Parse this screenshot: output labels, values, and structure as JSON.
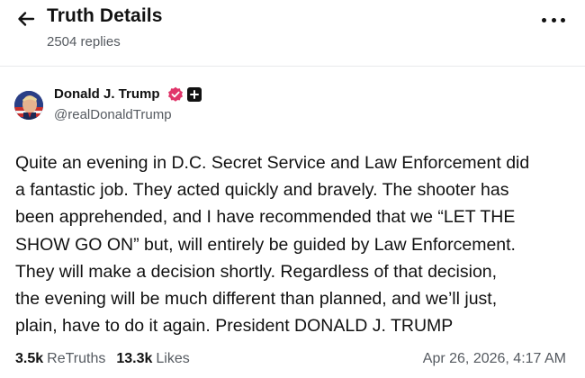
{
  "header": {
    "title": "Truth Details",
    "replies": "2504 replies"
  },
  "author": {
    "name": "Donald J. Trump",
    "handle": "@realDonaldTrump"
  },
  "post": {
    "text": "Quite an evening in D.C. Secret Service and Law Enforcement did\na fantastic job. They acted quickly and bravely. The shooter has\nbeen apprehended, and I have recommended that we “LET THE\nSHOW GO ON” but, will entirely be guided by Law Enforcement.\nThey will make a decision shortly. Regardless of that decision,\nthe evening will be much different than planned, and we’ll just,\nplain, have to do it again. President DONALD J. TRUMP"
  },
  "stats": {
    "retruths_count": "3.5k",
    "retruths_label": "ReTruths",
    "likes_count": "13.3k",
    "likes_label": "Likes"
  },
  "timestamp": "Apr 26, 2026, 4:17 AM",
  "colors": {
    "verified": "#e0356a",
    "text_primary": "#111111",
    "text_secondary": "#555a60"
  },
  "icons": {
    "back": "arrow-left-icon",
    "more": "more-horizontal-icon",
    "verified": "verified-badge-icon",
    "plus": "plus-square-icon"
  }
}
